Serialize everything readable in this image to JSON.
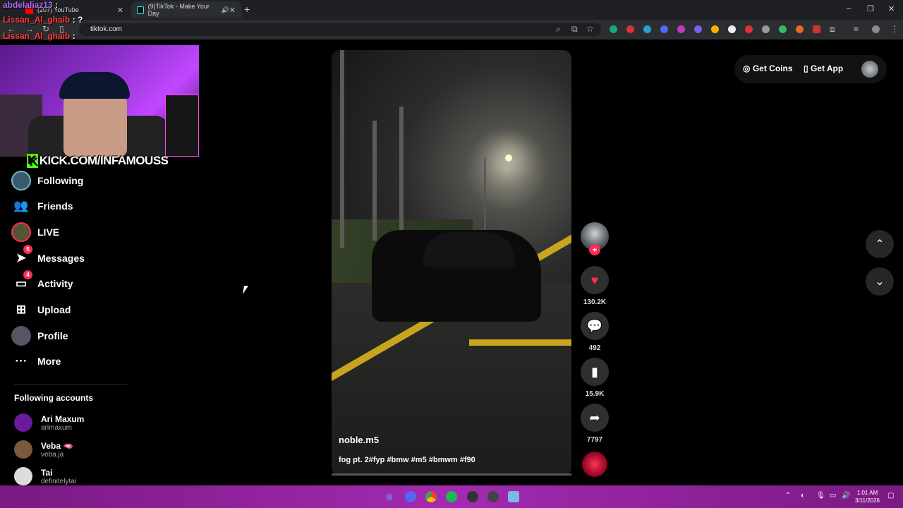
{
  "browser": {
    "tabs": [
      {
        "title": "(207) YouTube",
        "active": false
      },
      {
        "title": "(9)TikTok - Make Your Day",
        "active": true
      }
    ],
    "new_tab": "+",
    "url": "tiktok.com",
    "window_controls": {
      "minimize": "–",
      "restore": "❐",
      "close": "✕"
    }
  },
  "overlay_chat": [
    {
      "user": "abdelaliaz13",
      "message": ":"
    },
    {
      "user": "Lissan_Al_ghaib",
      "message": ": ?"
    },
    {
      "user": "Lissan_Al_ghaib",
      "message": ":"
    }
  ],
  "stream_banner": {
    "logo_letter": "K",
    "text": "KICK.COM/INFAMOUSS"
  },
  "sidebar": {
    "items": [
      {
        "label": "Following",
        "icon": "following-avatar-icon"
      },
      {
        "label": "Friends",
        "icon": "friends-icon"
      },
      {
        "label": "LIVE",
        "icon": "live-avatar-icon"
      },
      {
        "label": "Messages",
        "icon": "messages-icon",
        "badge": "5"
      },
      {
        "label": "Activity",
        "icon": "activity-icon",
        "badge": "4"
      },
      {
        "label": "Upload",
        "icon": "upload-icon"
      },
      {
        "label": "Profile",
        "icon": "profile-avatar-icon"
      },
      {
        "label": "More",
        "icon": "more-icon"
      }
    ],
    "following_header": "Following accounts",
    "accounts": [
      {
        "name": "Ari Maxum",
        "handle": "arimaxum",
        "color": "#6a1a9a"
      },
      {
        "name": "Veba 🫦",
        "handle": "veba.ja",
        "color": "#7a5a3a"
      },
      {
        "name": "Tai",
        "handle": "definitelytai",
        "color": "#dddddd"
      }
    ]
  },
  "header": {
    "get_coins": "Get Coins",
    "get_app": "Get App"
  },
  "video": {
    "username": "noble.m5",
    "description": "fog pt. 2#fyp #bmw #m5 #bmwm #f90",
    "progress": 0.0
  },
  "actions": {
    "likes": "130.2K",
    "comments": "492",
    "saves": "15.9K",
    "shares": "7797"
  },
  "taskbar": {
    "time": "1:01 AM",
    "date": "3/11/2026"
  },
  "colors": {
    "accent": "#fe2c55",
    "taskbar": "#a32ab1",
    "kick_green": "#53fc18"
  }
}
